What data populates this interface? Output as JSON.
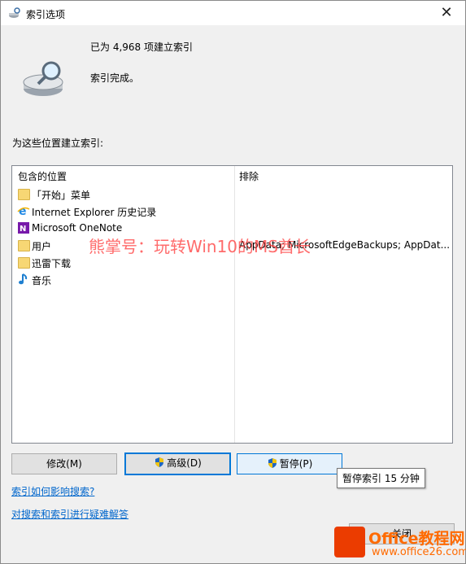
{
  "window": {
    "title": "索引选项",
    "close_glyph": "✕"
  },
  "status": {
    "indexed_count": "已为 4,968 项建立索引",
    "state": "索引完成。"
  },
  "locations": {
    "label": "为这些位置建立索引:",
    "columns": {
      "included": "包含的位置",
      "excluded": "排除"
    },
    "rows": [
      {
        "icon": "folder-icon",
        "name": "「开始」菜单",
        "excluded": ""
      },
      {
        "icon": "internet-explorer-icon",
        "name": "Internet Explorer 历史记录",
        "excluded": ""
      },
      {
        "icon": "onenote-icon",
        "name": "Microsoft OneNote",
        "excluded": ""
      },
      {
        "icon": "folder-icon",
        "name": "用户",
        "excluded": "AppData; MicrosoftEdgeBackups; AppDat..."
      },
      {
        "icon": "folder-icon",
        "name": "迅雷下载",
        "excluded": ""
      },
      {
        "icon": "music-note-icon",
        "name": "音乐",
        "excluded": ""
      }
    ]
  },
  "buttons": {
    "modify": "修改(M)",
    "advanced": "高级(D)",
    "pause": "暂停(P)",
    "close": "关闭"
  },
  "tooltip": "暂停索引 15 分钟",
  "links": {
    "how_indexing": "索引如何影响搜索?",
    "troubleshoot": "对搜索和索引进行疑难解答"
  },
  "watermark": "熊掌号：玩转Win10的MS酋长",
  "logo": {
    "brand": "Office教程网",
    "url": "www.office26.com"
  },
  "colors": {
    "accent": "#0078d7",
    "link": "#0066cc",
    "logo": "#ff6a00"
  }
}
